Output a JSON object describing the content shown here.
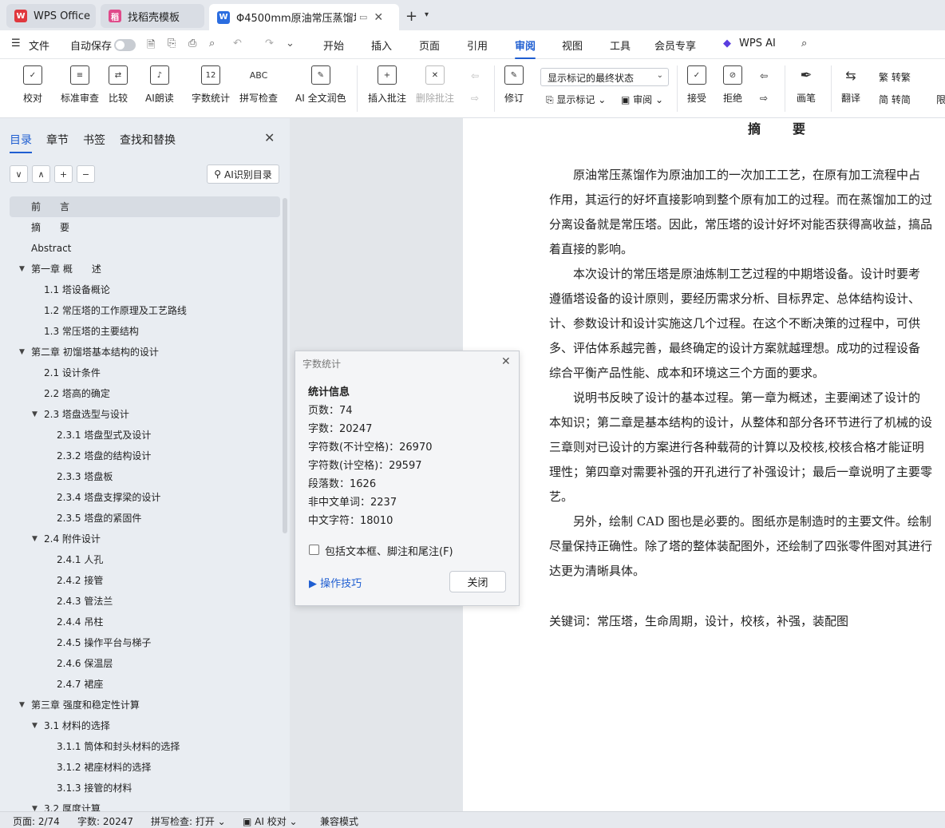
{
  "tabs": [
    {
      "label": "WPS Office"
    },
    {
      "label": "找稻壳模板"
    },
    {
      "label": "Φ4500mm原油常压蒸馏塔机"
    }
  ],
  "menu": {
    "file": "文件",
    "autosave": "自动保存",
    "items": [
      "开始",
      "插入",
      "页面",
      "引用",
      "审阅",
      "视图",
      "工具",
      "会员专享"
    ],
    "active": "审阅",
    "wps_ai": "WPS AI"
  },
  "ribbon": {
    "proofread": "校对",
    "std_review": "标准审查",
    "compare": "比较",
    "ai_read": "AI朗读",
    "word_count": "字数统计",
    "spell_check": "拼写检查",
    "ai_polish": "AI 全文润色",
    "insert_comment": "插入批注",
    "delete_comment": "删除批注",
    "revise": "修订",
    "markup_state": "显示标记的最终状态",
    "show_markup": "显示标记",
    "review": "审阅",
    "accept": "接受",
    "reject": "拒绝",
    "pen": "画笔",
    "translate": "翻译",
    "to_traditional": "转繁",
    "to_simplified": "转简",
    "limit": "限"
  },
  "leftpanel": {
    "tabs": [
      "目录",
      "章节",
      "书签",
      "查找和替换"
    ],
    "ai_toc": "AI识别目录",
    "toc": [
      {
        "label": "前　　言",
        "level": 1,
        "arrow": "",
        "selected": true
      },
      {
        "label": "摘　　要",
        "level": 1,
        "arrow": ""
      },
      {
        "label": "Abstract",
        "level": 1,
        "arrow": ""
      },
      {
        "label": "第一章  概　　述",
        "level": 1,
        "arrow": "down"
      },
      {
        "label": "1.1  塔设备概论",
        "level": 2,
        "arrow": ""
      },
      {
        "label": "1.2 常压塔的工作原理及工艺路线",
        "level": 2,
        "arrow": ""
      },
      {
        "label": "1.3 常压塔的主要结构",
        "level": 2,
        "arrow": ""
      },
      {
        "label": "第二章  初馏塔基本结构的设计",
        "level": 1,
        "arrow": "down"
      },
      {
        "label": "2.1  设计条件",
        "level": 2,
        "arrow": ""
      },
      {
        "label": "2.2  塔高的确定",
        "level": 2,
        "arrow": ""
      },
      {
        "label": "2.3  塔盘选型与设计",
        "level": 2,
        "arrow": "down"
      },
      {
        "label": "2.3.1  塔盘型式及设计",
        "level": 3,
        "arrow": ""
      },
      {
        "label": "2.3.2  塔盘的结构设计",
        "level": 3,
        "arrow": ""
      },
      {
        "label": "2.3.3  塔盘板",
        "level": 3,
        "arrow": ""
      },
      {
        "label": "2.3.4  塔盘支撑梁的设计",
        "level": 3,
        "arrow": ""
      },
      {
        "label": "2.3.5  塔盘的紧固件",
        "level": 3,
        "arrow": ""
      },
      {
        "label": "2.4  附件设计",
        "level": 2,
        "arrow": "down"
      },
      {
        "label": "2.4.1    人孔",
        "level": 3,
        "arrow": ""
      },
      {
        "label": "2.4.2  接管",
        "level": 3,
        "arrow": ""
      },
      {
        "label": "2.4.3  管法兰",
        "level": 3,
        "arrow": ""
      },
      {
        "label": "2.4.4  吊柱",
        "level": 3,
        "arrow": ""
      },
      {
        "label": "2.4.5  操作平台与梯子",
        "level": 3,
        "arrow": ""
      },
      {
        "label": "2.4.6  保温层",
        "level": 3,
        "arrow": ""
      },
      {
        "label": "2.4.7  裙座",
        "level": 3,
        "arrow": ""
      },
      {
        "label": "第三章  强度和稳定性计算",
        "level": 1,
        "arrow": "down"
      },
      {
        "label": "3.1  材料的选择",
        "level": 2,
        "arrow": "down"
      },
      {
        "label": "3.1.1  筒体和封头材料的选择",
        "level": 3,
        "arrow": ""
      },
      {
        "label": "3.1.2  裙座材料的选择",
        "level": 3,
        "arrow": ""
      },
      {
        "label": "3.1.3  接管的材料",
        "level": 3,
        "arrow": ""
      },
      {
        "label": "3.2  厚度计算",
        "level": 2,
        "arrow": "down"
      }
    ]
  },
  "document": {
    "title": "摘要",
    "lines": [
      "　　原油常压蒸馏作为原油加工的一次加工工艺，在原有加工流程中占",
      "作用，其运行的好坏直接影响到整个原有加工的过程。而在蒸馏加工的过",
      "分离设备就是常压塔。因此，常压塔的设计好坏对能否获得高收益，搞品",
      "着直接的影响。",
      "　　本次设计的常压塔是原油炼制工艺过程的中期塔设备。设计时要考",
      "遵循塔设备的设计原则，要经历需求分析、目标界定、总体结构设计、",
      "计、参数设计和设计实施这几个过程。在这个不断决策的过程中，可供",
      "多、评估体系越完善，最终确定的设计方案就越理想。成功的过程设备",
      "综合平衡产品性能、成本和环境这三个方面的要求。",
      "　　说明书反映了设计的基本过程。第一章为概述，主要阐述了设计的",
      "本知识；第二章是基本结构的设计，从整体和部分各环节进行了机械的设",
      "三章则对已设计的方案进行各种载荷的计算以及校核,校核合格才能证明",
      "理性；第四章对需要补强的开孔进行了补强设计；最后一章说明了主要零",
      "艺。",
      "　　另外，绘制 CAD 图也是必要的。图纸亦是制造时的主要文件。绘制",
      "尽量保持正确性。除了塔的整体装配图外，还绘制了四张零件图对其进行",
      "达更为清晰具体。"
    ],
    "keywords": "关键词：常压塔，生命周期，设计，校核，补强，装配图"
  },
  "dialog": {
    "title": "字数统计",
    "heading": "统计信息",
    "pages": "页数：74",
    "words": "字数：20247",
    "chars_no_space": "字符数(不计空格)：26970",
    "chars_with_space": "字符数(计空格)：29597",
    "paragraphs": "段落数：1626",
    "non_cn_words": "非中文单词：2237",
    "cn_chars": "中文字符：18010",
    "include_label": "包括文本框、脚注和尾注(F)",
    "include_checked": false,
    "tips": "操作技巧",
    "close": "关闭"
  },
  "statusbar": {
    "page": "页面: 2/74",
    "words": "字数: 20247",
    "spell": "拼写检查: 打开",
    "ai_check": "AI 校对",
    "compat": "兼容模式"
  },
  "colors": {
    "accent": "#1f5ed1",
    "wps_red": "#e0383e",
    "doc_blue": "#2b6de0"
  }
}
